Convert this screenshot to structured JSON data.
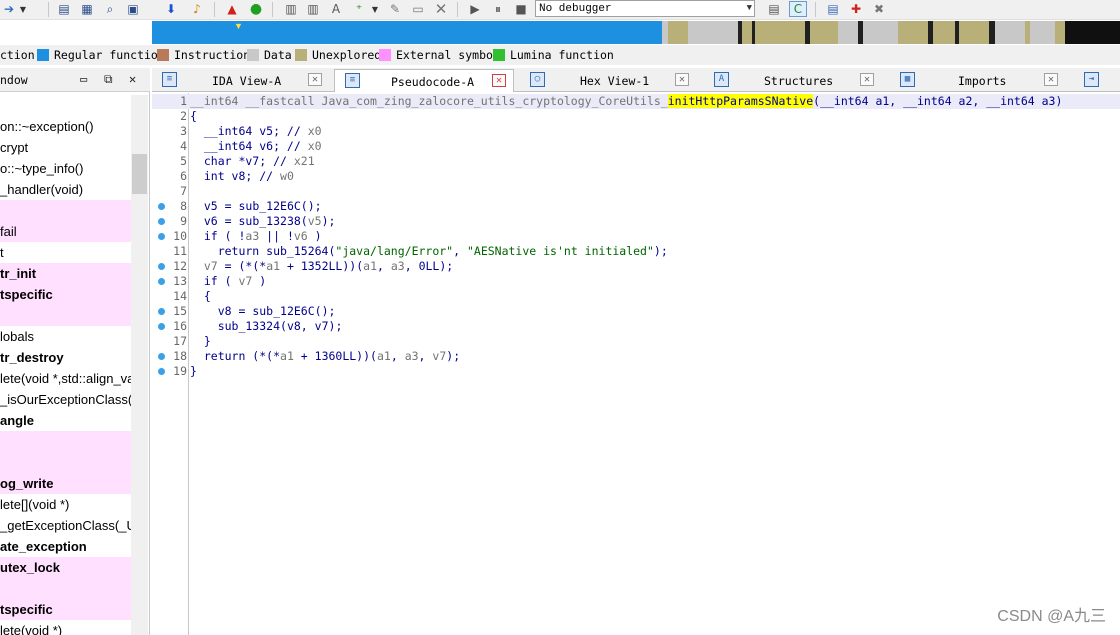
{
  "toolbar": {
    "debugger_value": "No debugger",
    "icons": [
      "forward-icon",
      "dropdown-arrow-icon",
      "structure-icon",
      "xref-icon",
      "search-icon",
      "jump-down-icon",
      "find-icon",
      "warning-icon",
      "run-green-icon",
      "code-icon",
      "data-icon",
      "string-icon",
      "offset-icon",
      "patch-icon",
      "edit-icon",
      "undefine-icon",
      "play-icon",
      "pause-icon",
      "stop-icon",
      "debugger-select-icon",
      "source-icon",
      "breakpoint-icon",
      "hook-icon"
    ]
  },
  "legend": [
    {
      "label": "ction",
      "color": ""
    },
    {
      "label": "Regular function",
      "color": "#1e90e0"
    },
    {
      "label": "Instruction",
      "color": "#b87a5a"
    },
    {
      "label": "Data",
      "color": "#c8c8c8"
    },
    {
      "label": "Unexplored",
      "color": "#b8b078"
    },
    {
      "label": "External symbol",
      "color": "#ff90ff"
    },
    {
      "label": "Lumina function",
      "color": "#30c030"
    }
  ],
  "left_pane": {
    "title": "ndow",
    "functions": [
      {
        "name": "",
        "pink": false,
        "bold": false
      },
      {
        "name": "on::~exception()",
        "pink": false,
        "bold": false
      },
      {
        "name": "crypt",
        "pink": false,
        "bold": false
      },
      {
        "name": "o::~type_info()",
        "pink": false,
        "bold": false
      },
      {
        "name": "_handler(void)",
        "pink": false,
        "bold": false
      },
      {
        "name": "",
        "pink": true,
        "bold": false
      },
      {
        "name": "fail",
        "pink": true,
        "bold": false
      },
      {
        "name": "t",
        "pink": false,
        "bold": false
      },
      {
        "name": "tr_init",
        "pink": true,
        "bold": true
      },
      {
        "name": "tspecific",
        "pink": true,
        "bold": true
      },
      {
        "name": "",
        "pink": true,
        "bold": false
      },
      {
        "name": "lobals",
        "pink": false,
        "bold": false
      },
      {
        "name": "tr_destroy",
        "pink": false,
        "bold": true
      },
      {
        "name": "lete(void *,std::align_va",
        "pink": false,
        "bold": false
      },
      {
        "name": "_isOurExceptionClass(_",
        "pink": false,
        "bold": false
      },
      {
        "name": "angle",
        "pink": false,
        "bold": true
      },
      {
        "name": "",
        "pink": true,
        "bold": false
      },
      {
        "name": "",
        "pink": true,
        "bold": false
      },
      {
        "name": "og_write",
        "pink": true,
        "bold": true
      },
      {
        "name": "lete[](void *)",
        "pink": false,
        "bold": false
      },
      {
        "name": "_getExceptionClass(_Un",
        "pink": false,
        "bold": false
      },
      {
        "name": "ate_exception",
        "pink": false,
        "bold": true
      },
      {
        "name": "utex_lock",
        "pink": true,
        "bold": true
      },
      {
        "name": "",
        "pink": true,
        "bold": false
      },
      {
        "name": "tspecific",
        "pink": true,
        "bold": true
      },
      {
        "name": "lete(void *)",
        "pink": false,
        "bold": false
      }
    ]
  },
  "tabs": [
    {
      "label": "IDA View-A",
      "icon": "ida-view-icon",
      "active": false
    },
    {
      "label": "Pseudocode-A",
      "icon": "pseudocode-icon",
      "active": true
    },
    {
      "label": "Hex View-1",
      "icon": "hex-view-icon",
      "active": false
    },
    {
      "label": "Structures",
      "icon": "structures-icon",
      "active": false
    },
    {
      "label": "Imports",
      "icon": "imports-icon",
      "active": false
    }
  ],
  "code": [
    {
      "num": "1",
      "dot": false,
      "highlight": true
    },
    {
      "num": "2",
      "dot": false,
      "highlight": false
    },
    {
      "num": "3",
      "dot": false,
      "highlight": false
    },
    {
      "num": "4",
      "dot": false,
      "highlight": false
    },
    {
      "num": "5",
      "dot": false,
      "highlight": false
    },
    {
      "num": "6",
      "dot": false,
      "highlight": false
    },
    {
      "num": "7",
      "dot": false,
      "highlight": false
    },
    {
      "num": "8",
      "dot": true,
      "highlight": false
    },
    {
      "num": "9",
      "dot": true,
      "highlight": false
    },
    {
      "num": "10",
      "dot": true,
      "highlight": false
    },
    {
      "num": "11",
      "dot": false,
      "highlight": false
    },
    {
      "num": "12",
      "dot": true,
      "highlight": false
    },
    {
      "num": "13",
      "dot": true,
      "highlight": false
    },
    {
      "num": "14",
      "dot": false,
      "highlight": false
    },
    {
      "num": "15",
      "dot": true,
      "highlight": false
    },
    {
      "num": "16",
      "dot": true,
      "highlight": false
    },
    {
      "num": "17",
      "dot": false,
      "highlight": false
    },
    {
      "num": "18",
      "dot": true,
      "highlight": false
    },
    {
      "num": "19",
      "dot": true,
      "highlight": false
    }
  ],
  "code_text": {
    "l1_pre": "__int64 __fastcall Java_com_zing_zalocore_utils_cryptology_CoreUtils_",
    "l1_fn": "initHttpParamsSNative",
    "l1_post": "(__int64 a1, __int64 a2, __int64 a3)",
    "l2": "{",
    "l3_a": "  __int64 v5; // ",
    "l3_b": "x0",
    "l4_a": "  __int64 v6; // ",
    "l4_b": "x0",
    "l5_a": "  char *v7; // ",
    "l5_b": "x21",
    "l6_a": "  int v8; // ",
    "l6_b": "w0",
    "l7": "",
    "l8_a": "  ",
    "l8_v": "v5",
    "l8_b": " = sub_12E6C();",
    "l9_a": "  ",
    "l9_v": "v6",
    "l9_b": " = sub_13238(",
    "l9_v2": "v5",
    "l9_c": ");",
    "l10_a": "  if ( !",
    "l10_v": "a3",
    "l10_b": " || !",
    "l10_v2": "v6",
    "l10_c": " )",
    "l11_a": "    return sub_15264(",
    "l11_s1": "\"java/lang/Error\"",
    "l11_b": ", ",
    "l11_s2": "\"AESNative is'nt initialed\"",
    "l11_c": ");",
    "l12_a": "  ",
    "l12_v": "v7",
    "l12_b": " = (*(*",
    "l12_v2": "a1",
    "l12_c": " + 1352LL))(",
    "l12_v3": "a1",
    "l12_d": ", ",
    "l12_v4": "a3",
    "l12_e": ", 0LL);",
    "l13_a": "  if ( ",
    "l13_v": "v7",
    "l13_b": " )",
    "l14": "  {",
    "l15_a": "    ",
    "l15_v": "v8",
    "l15_b": " = sub_12E6C();",
    "l16_a": "    sub_13324(",
    "l16_v": "v8",
    "l16_b": ", ",
    "l16_v2": "v7",
    "l16_c": ");",
    "l17": "  }",
    "l18_a": "  return (*(*",
    "l18_v": "a1",
    "l18_b": " + 1360LL))(",
    "l18_v2": "a1",
    "l18_c": ", ",
    "l18_v3": "a3",
    "l18_d": ", ",
    "l18_v4": "v7",
    "l18_e": ");",
    "l19": "}"
  },
  "watermark": "CSDN @A九三"
}
